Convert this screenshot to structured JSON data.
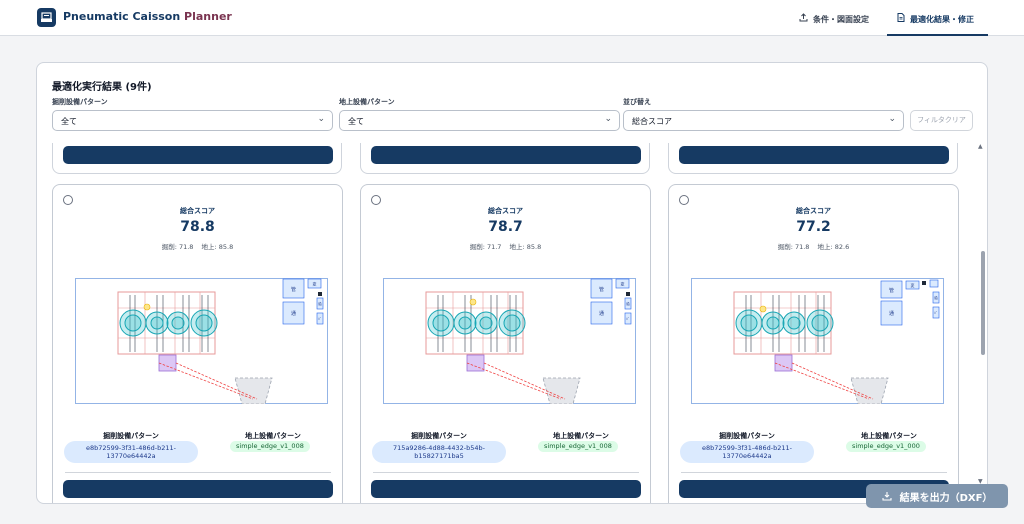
{
  "app": {
    "title_main": "Pneumatic Caisson ",
    "title_accent": "Planner"
  },
  "tabs": [
    {
      "label": "条件・図面設定",
      "icon": "upload-icon"
    },
    {
      "label": "最適化結果・修正",
      "icon": "document-icon",
      "active": true
    }
  ],
  "results": {
    "title": "最適化実行結果 (9件)",
    "filters": [
      {
        "label": "掘削設備パターン",
        "value": "全て"
      },
      {
        "label": "地上設備パターン",
        "value": "全て"
      },
      {
        "label": "並び替え",
        "value": "総合スコア"
      }
    ],
    "clear_label": "フィルタクリア"
  },
  "cards": [
    {
      "score_label": "総合スコア",
      "score": "78.8",
      "excavation_score": "掘削: 71.8",
      "ground_score": "地上: 85.8",
      "excavation_label": "掘削設備パターン",
      "excavation_id": "e8b72599-3f31-486d-b211-13770e64442a",
      "ground_label": "地上設備パターン",
      "ground_id": "simple_edge_v1_008",
      "labels": {
        "a": "管",
        "b": "通",
        "c": "変",
        "d": "給",
        "e": "ﾊﾞ"
      }
    },
    {
      "score_label": "総合スコア",
      "score": "78.7",
      "excavation_score": "掘削: 71.7",
      "ground_score": "地上: 85.8",
      "excavation_label": "掘削設備パターン",
      "excavation_id": "715a9286-4d88-4432-b54b-b15827171ba5",
      "ground_label": "地上設備パターン",
      "ground_id": "simple_edge_v1_008",
      "labels": {
        "a": "管",
        "b": "通",
        "c": "変",
        "d": "給",
        "e": "ﾊﾞ"
      }
    },
    {
      "score_label": "総合スコア",
      "score": "77.2",
      "excavation_score": "掘削: 71.8",
      "ground_score": "地上: 82.6",
      "excavation_label": "掘削設備パターン",
      "excavation_id": "e8b72599-3f31-486d-b211-13770e64442a",
      "ground_label": "地上設備パターン",
      "ground_id": "simple_edge_v1_000",
      "labels": {
        "a": "管",
        "b": "通",
        "c": "変",
        "d": "給",
        "e": "ﾊﾞ"
      }
    }
  ],
  "export": {
    "label": "結果を出力（DXF）",
    "icon": "download-icon"
  },
  "colors": {
    "primary": "#163a63",
    "accent": "#7a3450",
    "export": "#7f95ad"
  }
}
